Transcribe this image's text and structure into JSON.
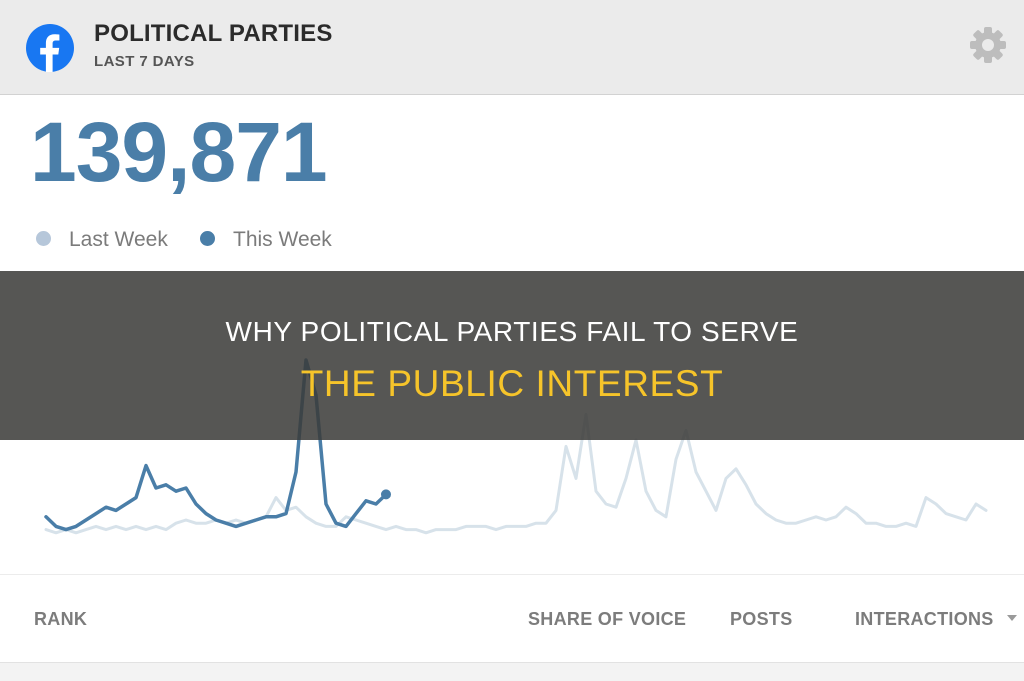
{
  "header": {
    "title": "POLITICAL PARTIES",
    "subtitle": "LAST 7 DAYS",
    "logo_icon": "facebook-icon",
    "settings_icon": "gear-icon"
  },
  "metric": {
    "value": "139,871"
  },
  "legend": [
    {
      "label": "Last Week",
      "color": "#b6c7da"
    },
    {
      "label": "This Week",
      "color": "#4a7ea8"
    }
  ],
  "chart_data": {
    "type": "line",
    "series": [
      {
        "name": "Last Week",
        "color": "#d7e2ea",
        "x": [
          0,
          10,
          20,
          30,
          40,
          50,
          60,
          70,
          80,
          90,
          100,
          110,
          120,
          130,
          140,
          150,
          160,
          170,
          180,
          190,
          200,
          210,
          220,
          230,
          240,
          250,
          260,
          270,
          280,
          290,
          300,
          310,
          320,
          330,
          340,
          350,
          360,
          370,
          380,
          390,
          400,
          410,
          420,
          430,
          440,
          450,
          460,
          470,
          480,
          490,
          500,
          510,
          520,
          530,
          540,
          550,
          560,
          570,
          580,
          590,
          600,
          610,
          620,
          630,
          640,
          650,
          660,
          670,
          680,
          690,
          700,
          710,
          720,
          730,
          740,
          750,
          760,
          770,
          780,
          790,
          800,
          810,
          820,
          830,
          840,
          850,
          860,
          870,
          880,
          890,
          900,
          910,
          920,
          930,
          940
        ],
        "y": [
          2,
          1,
          2,
          1,
          2,
          3,
          2,
          3,
          2,
          3,
          2,
          3,
          2,
          4,
          5,
          4,
          4,
          5,
          4,
          5,
          4,
          5,
          6,
          12,
          8,
          9,
          6,
          4,
          3,
          3,
          6,
          5,
          4,
          3,
          2,
          3,
          2,
          2,
          1,
          2,
          2,
          2,
          3,
          3,
          3,
          2,
          3,
          3,
          3,
          4,
          4,
          8,
          28,
          18,
          38,
          14,
          10,
          9,
          18,
          30,
          14,
          8,
          6,
          24,
          33,
          20,
          14,
          8,
          18,
          21,
          16,
          10,
          7,
          5,
          4,
          4,
          5,
          6,
          5,
          6,
          9,
          7,
          4,
          4,
          3,
          3,
          4,
          3,
          12,
          10,
          7,
          6,
          5,
          10,
          8
        ]
      },
      {
        "name": "This Week",
        "color": "#4a7ea8",
        "x": [
          0,
          10,
          20,
          30,
          40,
          50,
          60,
          70,
          80,
          90,
          100,
          110,
          120,
          130,
          140,
          150,
          160,
          170,
          180,
          190,
          200,
          210,
          220,
          230,
          240,
          250,
          260,
          270,
          280,
          290,
          300,
          310,
          320,
          330,
          340
        ],
        "y": [
          6,
          3,
          2,
          3,
          5,
          7,
          9,
          8,
          10,
          12,
          22,
          15,
          16,
          14,
          15,
          10,
          7,
          5,
          4,
          3,
          4,
          5,
          6,
          6,
          7,
          20,
          55,
          44,
          10,
          4,
          3,
          7,
          11,
          10,
          13
        ]
      }
    ]
  },
  "headline": {
    "line1": "WHY POLITICAL PARTIES FAIL TO SERVE",
    "line2": "THE PUBLIC INTEREST"
  },
  "table": {
    "columns": [
      "RANK",
      "SHARE OF VOICE",
      "POSTS",
      "INTERACTIONS"
    ],
    "sort_icon": "caret-down-icon"
  }
}
